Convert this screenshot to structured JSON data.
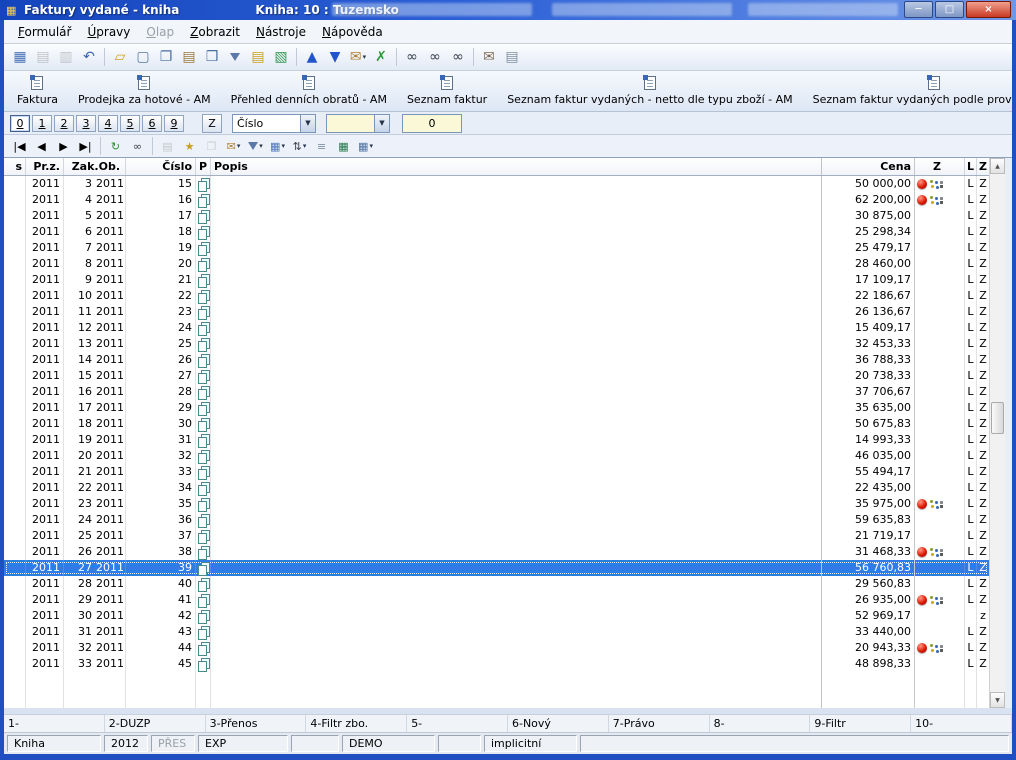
{
  "window": {
    "title": "Faktury vydané - kniha",
    "book_label": "Kniha: 10 : Tuzemsko",
    "controls": {
      "minimize": "─",
      "maximize": "□",
      "close": "×"
    }
  },
  "menu": {
    "items": [
      {
        "label": "Formulář",
        "enabled": true
      },
      {
        "label": "Úpravy",
        "enabled": true
      },
      {
        "label": "Olap",
        "enabled": false
      },
      {
        "label": "Zobrazit",
        "enabled": true
      },
      {
        "label": "Nástroje",
        "enabled": true
      },
      {
        "label": "Nápověda",
        "enabled": true
      }
    ]
  },
  "toolbar": {
    "icons": [
      {
        "name": "design-grid-icon",
        "glyph": "▦",
        "color": "#4a74b8"
      },
      {
        "name": "save-icon",
        "glyph": "▤",
        "color": "#7a8aa0",
        "disabled": true
      },
      {
        "name": "save-all-icon",
        "glyph": "▥",
        "color": "#7a8aa0",
        "disabled": true
      },
      {
        "name": "undo-icon",
        "glyph": "↶",
        "color": "#3a64b0",
        "sep_after": true
      },
      {
        "name": "open-folder-icon",
        "glyph": "▱",
        "color": "#d4a017"
      },
      {
        "name": "new-document-icon",
        "glyph": "▢",
        "color": "#5878a0"
      },
      {
        "name": "copy-icon",
        "glyph": "❐",
        "color": "#4a6fa0"
      },
      {
        "name": "paste-icon",
        "glyph": "▤",
        "color": "#9a7a40"
      },
      {
        "name": "duplicate-icon",
        "glyph": "❒",
        "color": "#4a6fa0"
      },
      {
        "name": "filter-funnel-icon",
        "funnel": true,
        "color": "#5a78a8"
      },
      {
        "name": "sheets-icon",
        "glyph": "▤",
        "color": "#caa21c"
      },
      {
        "name": "catalog-icon",
        "glyph": "▧",
        "color": "#3a9a58",
        "sep_after": true
      },
      {
        "name": "move-up-icon",
        "glyph": "▲",
        "color": "#2255cc"
      },
      {
        "name": "move-down-icon",
        "glyph": "▼",
        "color": "#2255cc"
      },
      {
        "name": "send-mail-icon",
        "glyph": "✉",
        "color": "#b08030",
        "dropdown": true
      },
      {
        "name": "export-icon",
        "glyph": "✗",
        "color": "#2a9a3a",
        "sep_after": true
      },
      {
        "name": "find-icon",
        "glyph": "∞",
        "color": "#3a4250"
      },
      {
        "name": "find-document-icon",
        "glyph": "∞",
        "color": "#3a4250"
      },
      {
        "name": "find-add-icon",
        "glyph": "∞",
        "color": "#3a4250",
        "sep_after": true
      },
      {
        "name": "mail-icon",
        "glyph": "✉",
        "color": "#806850"
      },
      {
        "name": "report-icon",
        "glyph": "▤",
        "color": "#8090a0"
      }
    ]
  },
  "report_buttons": {
    "items": [
      {
        "label": "Faktura"
      },
      {
        "label": "Prodejka za hotové - AM"
      },
      {
        "label": "Přehled denních obratů - AM"
      },
      {
        "label": "Seznam faktur"
      },
      {
        "label": "Seznam faktur vydaných - netto dle typu zboží - AM"
      },
      {
        "label": "Seznam faktur vydaných podle provize - AM"
      }
    ],
    "more_glyph": "▼"
  },
  "filter_bar": {
    "page_buttons": [
      "0",
      "1",
      "2",
      "3",
      "4",
      "5",
      "6",
      "9"
    ],
    "active_page": "0",
    "z_button": "Z",
    "column_select": {
      "value": "Číslo"
    },
    "filter_select": {
      "value": ""
    },
    "count_field": {
      "value": "0"
    }
  },
  "nav_toolbar": {
    "icons": [
      {
        "name": "first-record-icon",
        "glyph": "|◀"
      },
      {
        "name": "previous-record-icon",
        "glyph": "◀"
      },
      {
        "name": "next-record-icon",
        "glyph": "▶"
      },
      {
        "name": "last-record-icon",
        "glyph": "▶|",
        "sep_after": true
      },
      {
        "name": "refresh-icon",
        "glyph": "↻",
        "color": "#2e8b2e"
      },
      {
        "name": "find-icon",
        "glyph": "∞",
        "color": "#3a4250",
        "sep_after": true
      },
      {
        "name": "print-icon",
        "glyph": "▤",
        "color": "#8090a0",
        "disabled": true
      },
      {
        "name": "favorite-icon",
        "glyph": "★",
        "color": "#c8a020"
      },
      {
        "name": "copy-icon",
        "glyph": "❐",
        "color": "#9aa2ae",
        "disabled": true
      },
      {
        "name": "mail-icon",
        "glyph": "✉",
        "color": "#b08030",
        "dropdown": true
      },
      {
        "name": "filter-funnel-icon",
        "funnel": true,
        "color": "#5a78a8",
        "dropdown": true
      },
      {
        "name": "layout-icon",
        "glyph": "▦",
        "color": "#4a74b8",
        "dropdown": true
      },
      {
        "name": "sort-icon",
        "glyph": "⇅",
        "color": "#3a4250",
        "dropdown": true
      },
      {
        "name": "checklist-icon",
        "glyph": "≡",
        "color": "#8090a0"
      },
      {
        "name": "excel-icon",
        "glyph": "▦",
        "color": "#217346"
      },
      {
        "name": "table-icon",
        "glyph": "▦",
        "color": "#4a6fa0",
        "dropdown": true
      }
    ]
  },
  "grid": {
    "headers": {
      "s": "s",
      "prz": "Pr.z.",
      "zakob": "Zak.Ob.",
      "cislo": "Číslo",
      "p": "P",
      "popis": "Popis",
      "cena": "Cena",
      "z": "Z",
      "l": "L",
      "z2": "Z"
    },
    "selected_index": 24,
    "rows": [
      {
        "prz": "2011",
        "zak": "3",
        "ob": "2011",
        "cislo": "15",
        "popis": "",
        "cena": "50 000,00",
        "flags": true,
        "l": "L",
        "z": "Z"
      },
      {
        "prz": "2011",
        "zak": "4",
        "ob": "2011",
        "cislo": "16",
        "popis": "",
        "cena": "62 200,00",
        "flags": true,
        "l": "L",
        "z": "Z"
      },
      {
        "prz": "2011",
        "zak": "5",
        "ob": "2011",
        "cislo": "17",
        "popis": "",
        "cena": "30 875,00",
        "flags": false,
        "l": "L",
        "z": "Z"
      },
      {
        "prz": "2011",
        "zak": "6",
        "ob": "2011",
        "cislo": "18",
        "popis": "",
        "cena": "25 298,34",
        "flags": false,
        "l": "L",
        "z": "Z"
      },
      {
        "prz": "2011",
        "zak": "7",
        "ob": "2011",
        "cislo": "19",
        "popis": "",
        "cena": "25 479,17",
        "flags": false,
        "l": "L",
        "z": "Z"
      },
      {
        "prz": "2011",
        "zak": "8",
        "ob": "2011",
        "cislo": "20",
        "popis": "",
        "cena": "28 460,00",
        "flags": false,
        "l": "L",
        "z": "Z"
      },
      {
        "prz": "2011",
        "zak": "9",
        "ob": "2011",
        "cislo": "21",
        "popis": "",
        "cena": "17 109,17",
        "flags": false,
        "l": "L",
        "z": "Z"
      },
      {
        "prz": "2011",
        "zak": "10",
        "ob": "2011",
        "cislo": "22",
        "popis": "",
        "cena": "22 186,67",
        "flags": false,
        "l": "L",
        "z": "Z"
      },
      {
        "prz": "2011",
        "zak": "11",
        "ob": "2011",
        "cislo": "23",
        "popis": "",
        "cena": "26 136,67",
        "flags": false,
        "l": "L",
        "z": "Z"
      },
      {
        "prz": "2011",
        "zak": "12",
        "ob": "2011",
        "cislo": "24",
        "popis": "",
        "cena": "15 409,17",
        "flags": false,
        "l": "L",
        "z": "Z"
      },
      {
        "prz": "2011",
        "zak": "13",
        "ob": "2011",
        "cislo": "25",
        "popis": "",
        "cena": "32 453,33",
        "flags": false,
        "l": "L",
        "z": "Z"
      },
      {
        "prz": "2011",
        "zak": "14",
        "ob": "2011",
        "cislo": "26",
        "popis": "",
        "cena": "36 788,33",
        "flags": false,
        "l": "L",
        "z": "Z"
      },
      {
        "prz": "2011",
        "zak": "15",
        "ob": "2011",
        "cislo": "27",
        "popis": "",
        "cena": "20 738,33",
        "flags": false,
        "l": "L",
        "z": "Z"
      },
      {
        "prz": "2011",
        "zak": "16",
        "ob": "2011",
        "cislo": "28",
        "popis": "",
        "cena": "37 706,67",
        "flags": false,
        "l": "L",
        "z": "Z"
      },
      {
        "prz": "2011",
        "zak": "17",
        "ob": "2011",
        "cislo": "29",
        "popis": "",
        "cena": "35 635,00",
        "flags": false,
        "l": "L",
        "z": "Z"
      },
      {
        "prz": "2011",
        "zak": "18",
        "ob": "2011",
        "cislo": "30",
        "popis": "",
        "cena": "50 675,83",
        "flags": false,
        "l": "L",
        "z": "Z"
      },
      {
        "prz": "2011",
        "zak": "19",
        "ob": "2011",
        "cislo": "31",
        "popis": "",
        "cena": "14 993,33",
        "flags": false,
        "l": "L",
        "z": "Z"
      },
      {
        "prz": "2011",
        "zak": "20",
        "ob": "2011",
        "cislo": "32",
        "popis": "",
        "cena": "46 035,00",
        "flags": false,
        "l": "L",
        "z": "Z"
      },
      {
        "prz": "2011",
        "zak": "21",
        "ob": "2011",
        "cislo": "33",
        "popis": "",
        "cena": "55 494,17",
        "flags": false,
        "l": "L",
        "z": "Z"
      },
      {
        "prz": "2011",
        "zak": "22",
        "ob": "2011",
        "cislo": "34",
        "popis": "",
        "cena": "22 435,00",
        "flags": false,
        "l": "L",
        "z": "Z"
      },
      {
        "prz": "2011",
        "zak": "23",
        "ob": "2011",
        "cislo": "35",
        "popis": "",
        "cena": "35 975,00",
        "flags": true,
        "l": "L",
        "z": "Z"
      },
      {
        "prz": "2011",
        "zak": "24",
        "ob": "2011",
        "cislo": "36",
        "popis": "",
        "cena": "59 635,83",
        "flags": false,
        "l": "L",
        "z": "Z"
      },
      {
        "prz": "2011",
        "zak": "25",
        "ob": "2011",
        "cislo": "37",
        "popis": "",
        "cena": "21 719,17",
        "flags": false,
        "l": "L",
        "z": "Z"
      },
      {
        "prz": "2011",
        "zak": "26",
        "ob": "2011",
        "cislo": "38",
        "popis": "",
        "cena": "31 468,33",
        "flags": true,
        "l": "L",
        "z": "Z"
      },
      {
        "prz": "2011",
        "zak": "27",
        "ob": "2011",
        "cislo": "39",
        "popis": "",
        "cena": "56 760,83",
        "flags": false,
        "l": "L",
        "z": "Z"
      },
      {
        "prz": "2011",
        "zak": "28",
        "ob": "2011",
        "cislo": "40",
        "popis": "",
        "cena": "29 560,83",
        "flags": false,
        "l": "L",
        "z": "Z"
      },
      {
        "prz": "2011",
        "zak": "29",
        "ob": "2011",
        "cislo": "41",
        "popis": "",
        "cena": "26 935,00",
        "flags": true,
        "l": "L",
        "z": "Z"
      },
      {
        "prz": "2011",
        "zak": "30",
        "ob": "2011",
        "cislo": "42",
        "popis": "",
        "cena": "52 969,17",
        "flags": false,
        "l": "",
        "z": "z"
      },
      {
        "prz": "2011",
        "zak": "31",
        "ob": "2011",
        "cislo": "43",
        "popis": "",
        "cena": "33 440,00",
        "flags": false,
        "l": "L",
        "z": "Z"
      },
      {
        "prz": "2011",
        "zak": "32",
        "ob": "2011",
        "cislo": "44",
        "popis": "",
        "cena": "20 943,33",
        "flags": true,
        "l": "L",
        "z": "Z"
      },
      {
        "prz": "2011",
        "zak": "33",
        "ob": "2011",
        "cislo": "45",
        "popis": "",
        "cena": "48 898,33",
        "flags": false,
        "l": "L",
        "z": "Z"
      }
    ]
  },
  "function_bar": {
    "items": [
      "1-",
      "2-DUZP",
      "3-Přenos",
      "4-Filtr zbo.",
      "5-",
      "6-Nový",
      "7-Právo",
      "8-",
      "9-Filtr",
      "10-"
    ]
  },
  "status_bar": {
    "cells": [
      {
        "text": "Kniha",
        "disabled": false
      },
      {
        "text": "2012",
        "disabled": false
      },
      {
        "text": "PŘES",
        "disabled": true
      },
      {
        "text": "EXP",
        "disabled": false
      },
      {
        "text": "",
        "disabled": false
      },
      {
        "text": "DEMO",
        "disabled": false
      },
      {
        "text": "",
        "disabled": false
      },
      {
        "text": "implicitní",
        "disabled": false
      },
      {
        "text": "",
        "disabled": false
      }
    ]
  },
  "colors": {
    "selection": "#2f7ce8",
    "frame": "#1f4fc0",
    "flag_red": "#d81010"
  }
}
